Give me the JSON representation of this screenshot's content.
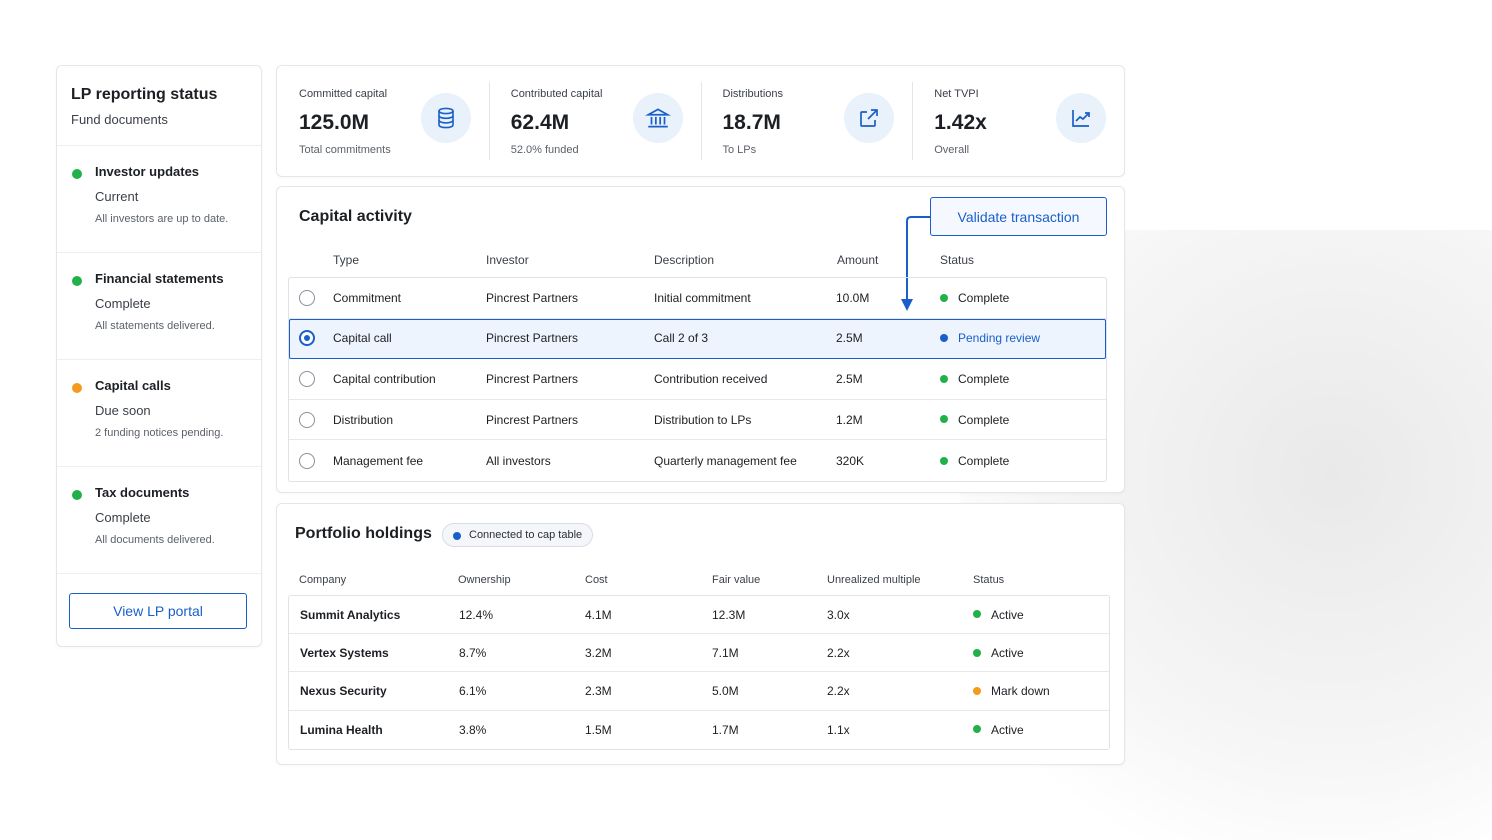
{
  "colors": {
    "accent": "#1a5fc9",
    "green": "#22b04b",
    "orange": "#f59a1b",
    "blue": "#1a5fc9"
  },
  "sidebar": {
    "title": "LP reporting status",
    "subtitle": "Fund documents",
    "items": [
      {
        "title": "Investor updates",
        "status": "Current",
        "note": "All investors are up to date.",
        "color": "green"
      },
      {
        "title": "Financial statements",
        "status": "Complete",
        "note": "All statements delivered.",
        "color": "green"
      },
      {
        "title": "Capital calls",
        "status": "Due soon",
        "note": "2 funding notices pending.",
        "color": "orange"
      },
      {
        "title": "Tax documents",
        "status": "Complete",
        "note": "All documents delivered.",
        "color": "green"
      }
    ],
    "button_label": "View LP portal"
  },
  "stats": [
    {
      "label": "Committed capital",
      "value": "125.0M",
      "sub": "Total commitments",
      "icon": "database-icon"
    },
    {
      "label": "Contributed capital",
      "value": "62.4M",
      "sub": "52.0% funded",
      "icon": "bank-icon"
    },
    {
      "label": "Distributions",
      "value": "18.7M",
      "sub": "To LPs",
      "icon": "external-link-icon"
    },
    {
      "label": "Net TVPI",
      "value": "1.42x",
      "sub": "Overall",
      "icon": "trending-up-icon"
    }
  ],
  "capital_activity": {
    "title": "Capital activity",
    "validate_label": "Validate transaction",
    "columns": [
      "Type",
      "Investor",
      "Description",
      "Amount",
      "Status"
    ],
    "rows": [
      {
        "type": "Commitment",
        "investor": "Pincrest Partners",
        "description": "Initial commitment",
        "amount": "10.0M",
        "status": "Complete",
        "selected": false
      },
      {
        "type": "Capital call",
        "investor": "Pincrest Partners",
        "description": "Call 2 of 3",
        "amount": "2.5M",
        "status": "Pending review",
        "selected": true
      },
      {
        "type": "Capital contribution",
        "investor": "Pincrest Partners",
        "description": "Contribution received",
        "amount": "2.5M",
        "status": "Complete",
        "selected": false
      },
      {
        "type": "Distribution",
        "investor": "Pincrest Partners",
        "description": "Distribution to LPs",
        "amount": "1.2M",
        "status": "Complete",
        "selected": false
      },
      {
        "type": "Management fee",
        "investor": "All investors",
        "description": "Quarterly management fee",
        "amount": "320K",
        "status": "Complete",
        "selected": false
      }
    ]
  },
  "portfolio": {
    "title": "Portfolio holdings",
    "badge": "Connected to cap table",
    "columns": [
      "Company",
      "Ownership",
      "Cost",
      "Fair value",
      "Unrealized multiple",
      "Status"
    ],
    "rows": [
      {
        "company": "Summit Analytics",
        "ownership": "12.4%",
        "cost": "4.1M",
        "fair_value": "12.3M",
        "multiple": "3.0x",
        "status": "Active",
        "color": "green"
      },
      {
        "company": "Vertex Systems",
        "ownership": "8.7%",
        "cost": "3.2M",
        "fair_value": "7.1M",
        "multiple": "2.2x",
        "status": "Active",
        "color": "green"
      },
      {
        "company": "Nexus Security",
        "ownership": "6.1%",
        "cost": "2.3M",
        "fair_value": "5.0M",
        "multiple": "2.2x",
        "status": "Mark down",
        "color": "orange"
      },
      {
        "company": "Lumina Health",
        "ownership": "3.8%",
        "cost": "1.5M",
        "fair_value": "1.7M",
        "multiple": "1.1x",
        "status": "Active",
        "color": "green"
      }
    ]
  }
}
